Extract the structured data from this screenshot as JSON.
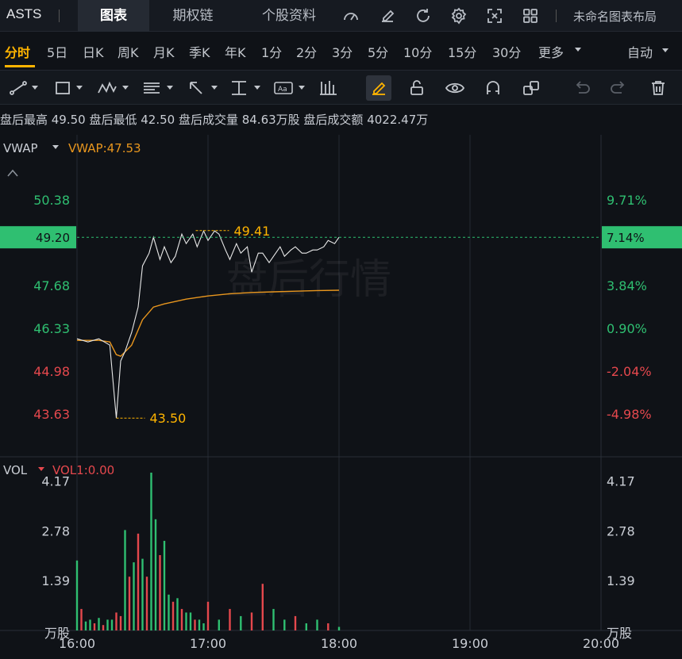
{
  "header": {
    "symbol": "ASTS",
    "tabs": [
      {
        "label": "图表",
        "active": true
      },
      {
        "label": "期权链",
        "active": false
      },
      {
        "label": "个股资料",
        "active": false
      }
    ],
    "toolbar_icons": [
      "gauge-icon",
      "edit-icon",
      "refresh-icon",
      "settings-icon",
      "fullscreen-icon",
      "grid-layout-icon"
    ],
    "layout_name": "未命名图表布局"
  },
  "periods": {
    "items": [
      "分时",
      "5日",
      "日K",
      "周K",
      "月K",
      "季K",
      "年K",
      "1分",
      "2分",
      "3分",
      "5分",
      "10分",
      "15分",
      "30分",
      "更多"
    ],
    "active": "分时",
    "auto_label": "自动"
  },
  "draw_tools": {
    "icons": [
      "trend-line-icon",
      "rectangle-icon",
      "wave-pattern-icon",
      "fib-levels-icon",
      "arrow-icon",
      "price-line-icon",
      "text-tool-icon",
      "candle-tool-icon",
      "pen-icon",
      "unlock-icon",
      "eye-icon",
      "magnet-icon",
      "clone-icon",
      "undo-icon",
      "redo-icon",
      "trash-icon"
    ]
  },
  "info": {
    "text": "盘后最高 49.50 盘后最低 42.50 盘后成交量 84.63万股 盘后成交额 4022.47万"
  },
  "price_panel": {
    "indicator_name": "VWAP",
    "indicator_value": "VWAP:47.53",
    "watermark": "盘后行情",
    "current_price": "49.20",
    "current_pct": "7.14%",
    "high_marker": "49.41",
    "low_marker": "43.50",
    "left_ticks": [
      "50.38",
      "47.68",
      "46.33",
      "44.98",
      "43.63"
    ],
    "right_ticks": [
      "9.71%",
      "3.84%",
      "0.90%",
      "-2.04%",
      "-4.98%"
    ]
  },
  "volume_panel": {
    "indicator_name": "VOL",
    "indicator_value": "VOL1:0.00",
    "ticks": [
      "4.17",
      "2.78",
      "1.39"
    ],
    "unit": "万股"
  },
  "time_axis": [
    "16:00",
    "17:00",
    "18:00",
    "19:00",
    "20:00"
  ],
  "colors": {
    "up": "#2fbf71",
    "down": "#e5484d",
    "accent": "#ffb400",
    "price_line": "#e8e8e8",
    "vwap_line": "#e8961e",
    "current_badge": "#2fbf71"
  },
  "chart_data": [
    {
      "type": "line",
      "x_range": [
        "16:00",
        "20:00"
      ],
      "ylim": [
        42.5,
        51.5
      ],
      "series": [
        {
          "name": "",
          "x": [
            "16:00",
            "16:05",
            "16:10",
            "16:15",
            "16:18",
            "16:20",
            "16:22",
            "16:25",
            "16:28",
            "16:30",
            "16:33",
            "16:35",
            "16:38",
            "16:40",
            "16:43",
            "16:45",
            "16:48",
            "16:50",
            "16:53",
            "16:55",
            "16:58",
            "17:00",
            "17:03",
            "17:05",
            "17:08",
            "17:10",
            "17:13",
            "17:15",
            "17:18",
            "17:20",
            "17:23",
            "17:25",
            "17:28",
            "17:30",
            "17:33",
            "17:35",
            "17:38",
            "17:40",
            "17:43",
            "17:45",
            "17:48",
            "17:50",
            "17:53",
            "17:55",
            "17:58",
            "18:00"
          ],
          "values": [
            46.0,
            45.9,
            46.0,
            45.8,
            43.5,
            45.3,
            45.6,
            46.2,
            47.0,
            48.3,
            48.7,
            49.2,
            48.5,
            48.9,
            48.4,
            48.6,
            49.3,
            49.0,
            49.3,
            48.9,
            49.4,
            49.1,
            49.4,
            49.3,
            48.8,
            48.5,
            49.0,
            48.7,
            48.9,
            48.1,
            48.7,
            48.7,
            48.4,
            48.6,
            48.9,
            48.6,
            48.8,
            48.9,
            48.7,
            48.7,
            48.8,
            48.8,
            48.9,
            49.1,
            49.0,
            49.2
          ]
        },
        {
          "name": "VWAP",
          "x": [
            "16:00",
            "16:10",
            "16:15",
            "16:18",
            "16:20",
            "16:25",
            "16:30",
            "16:35",
            "16:40",
            "16:50",
            "17:00",
            "17:10",
            "17:20",
            "17:30",
            "17:40",
            "17:50",
            "18:00"
          ],
          "values": [
            45.95,
            45.95,
            45.9,
            45.5,
            45.45,
            45.8,
            46.6,
            47.0,
            47.1,
            47.25,
            47.35,
            47.42,
            47.46,
            47.48,
            47.5,
            47.52,
            47.53
          ]
        }
      ]
    },
    {
      "type": "bar",
      "x_range": [
        "16:00",
        "20:00"
      ],
      "ylim": [
        0,
        4.6
      ],
      "ylabel": "万股",
      "x": [
        "16:00",
        "16:02",
        "16:04",
        "16:06",
        "16:08",
        "16:10",
        "16:12",
        "16:14",
        "16:16",
        "16:18",
        "16:20",
        "16:22",
        "16:24",
        "16:26",
        "16:28",
        "16:30",
        "16:32",
        "16:34",
        "16:36",
        "16:38",
        "16:40",
        "16:42",
        "16:44",
        "16:46",
        "16:48",
        "16:50",
        "16:52",
        "16:54",
        "16:56",
        "16:58",
        "17:00",
        "17:05",
        "17:10",
        "17:15",
        "17:20",
        "17:25",
        "17:30",
        "17:35",
        "17:40",
        "17:45",
        "17:50",
        "17:55",
        "18:00"
      ],
      "values": [
        1.95,
        0.6,
        0.25,
        0.3,
        0.2,
        0.35,
        0.15,
        0.3,
        0.3,
        0.5,
        0.4,
        2.8,
        1.5,
        1.9,
        2.7,
        2.0,
        1.5,
        4.4,
        3.1,
        2.1,
        2.5,
        1.0,
        0.8,
        0.9,
        0.6,
        0.5,
        0.5,
        0.3,
        0.3,
        0.2,
        0.8,
        0.3,
        0.6,
        0.4,
        0.5,
        1.3,
        0.6,
        0.3,
        0.4,
        0.2,
        0.3,
        0.2,
        0.1
      ],
      "up": [
        true,
        false,
        true,
        true,
        false,
        true,
        false,
        true,
        true,
        false,
        false,
        true,
        false,
        true,
        false,
        true,
        false,
        true,
        true,
        false,
        true,
        true,
        false,
        true,
        false,
        true,
        true,
        false,
        true,
        true,
        false,
        true,
        false,
        true,
        false,
        false,
        true,
        true,
        false,
        true,
        true,
        false,
        true
      ]
    }
  ]
}
